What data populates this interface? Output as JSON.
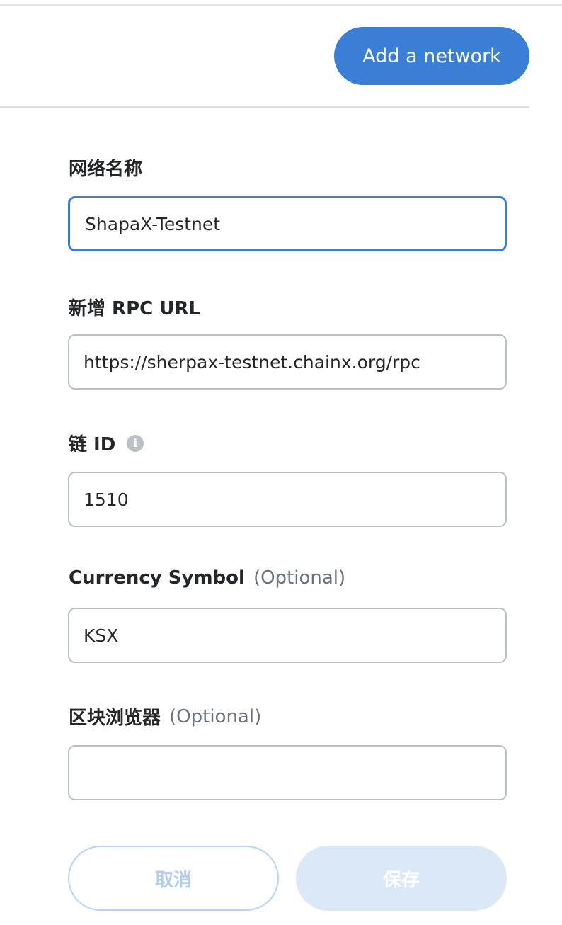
{
  "header": {
    "add_network_label": "Add a network"
  },
  "form": {
    "network_name": {
      "label": "网络名称",
      "value": "ShapaX-Testnet"
    },
    "rpc_url": {
      "label": "新增 RPC URL",
      "value": "https://sherpax-testnet.chainx.org/rpc"
    },
    "chain_id": {
      "label": "链 ID",
      "info_icon": "i",
      "value": "1510"
    },
    "currency_symbol": {
      "label": "Currency Symbol",
      "optional": "(Optional)",
      "value": "KSX"
    },
    "block_explorer": {
      "label": "区块浏览器",
      "optional": "(Optional)",
      "value": ""
    }
  },
  "footer": {
    "cancel_label": "取消",
    "save_label": "保存"
  },
  "colors": {
    "accent": "#3a7fd5",
    "disabled_fill": "#dbe8f7",
    "disabled_border": "#b9d4f1",
    "border": "#bbc0c5"
  }
}
